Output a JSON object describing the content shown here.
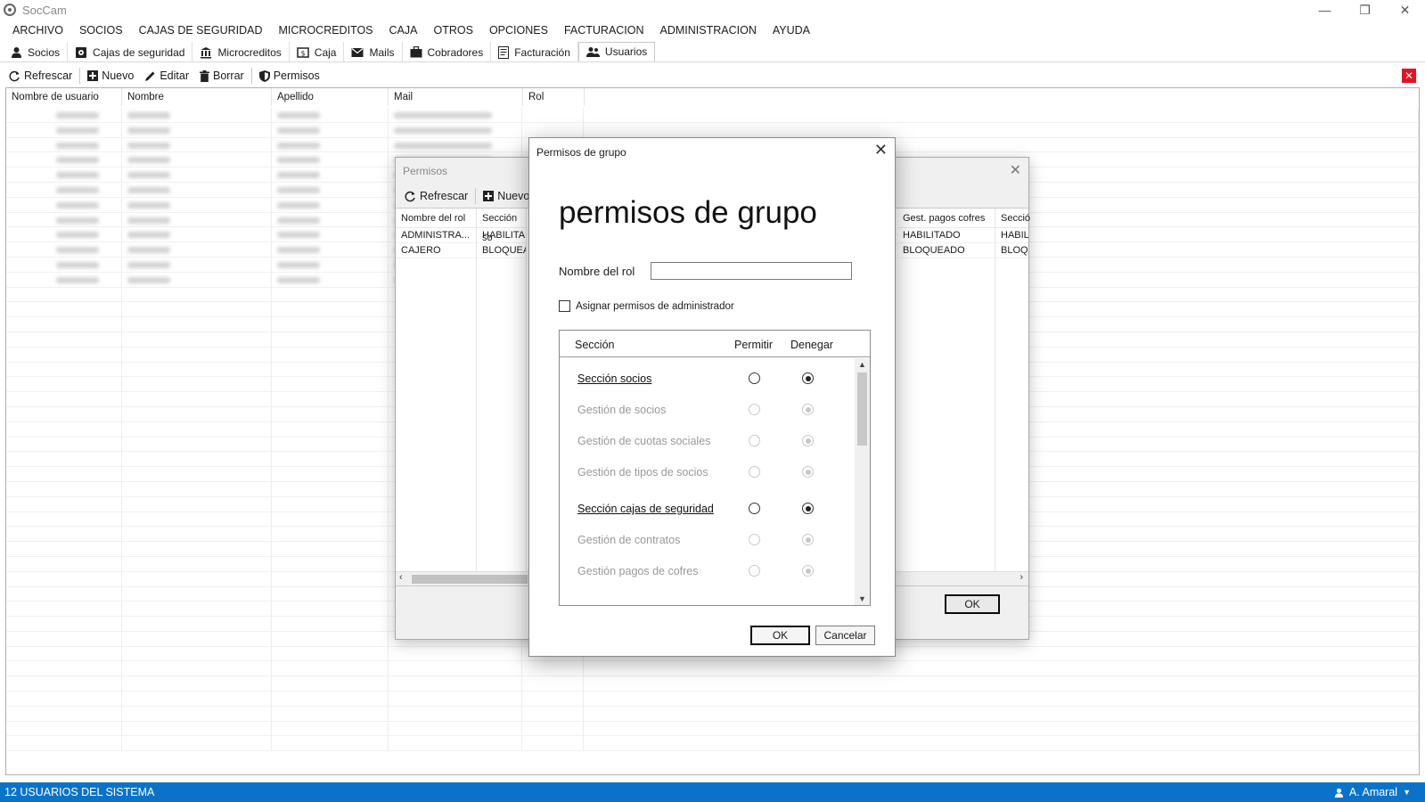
{
  "app": {
    "title": "SocCam"
  },
  "menu": [
    "ARCHIVO",
    "SOCIOS",
    "CAJAS DE SEGURIDAD",
    "MICROCREDITOS",
    "CAJA",
    "OTROS",
    "OPCIONES",
    "FACTURACION",
    "ADMINISTRACION",
    "AYUDA"
  ],
  "tabs": [
    "Socios",
    "Cajas de seguridad",
    "Microcreditos",
    "Caja",
    "Mails",
    "Cobradores",
    "Facturación",
    "Usuarios"
  ],
  "active_tab": "Usuarios",
  "toolbar": {
    "refresh": "Refrescar",
    "new": "Nuevo",
    "edit": "Editar",
    "delete": "Borrar",
    "permissions": "Permisos"
  },
  "grid": {
    "columns": [
      "Nombre de usuario",
      "Nombre",
      "Apellido",
      "Mail",
      "Rol"
    ]
  },
  "status": {
    "left": "12 USUARIOS DEL SISTEMA",
    "user": "A. Amaral"
  },
  "permisos_dialog": {
    "title": "Permisos",
    "refresh": "Refrescar",
    "new": "Nuevo",
    "col_role": "Nombre del rol",
    "col_section": "Sección so",
    "col_gest_pagos": "Gest. pagos cofres",
    "col_section_b": "Secció",
    "rows": [
      {
        "role": "ADMINISTRA...",
        "section": "HABILITAD",
        "gest": "HABILITADO",
        "section_b": "HABIL"
      },
      {
        "role": "CAJERO",
        "section": "BLOQUEA",
        "gest": "BLOQUEADO",
        "section_b": "BLOQU"
      }
    ],
    "ok": "OK"
  },
  "modal": {
    "window_title": "Permisos de grupo",
    "heading": "permisos de grupo",
    "role_label": "Nombre del rol",
    "role_value": "",
    "admin_label": "Asignar permisos de administrador",
    "admin_checked": false,
    "col_section": "Sección",
    "col_allow": "Permitir",
    "col_deny": "Denegar",
    "sections": [
      {
        "label": "Sección socios",
        "kind": "main",
        "value": "deny"
      },
      {
        "label": "Gestión de socios",
        "kind": "sub",
        "value": "deny"
      },
      {
        "label": "Gestión de cuotas sociales",
        "kind": "sub",
        "value": "deny"
      },
      {
        "label": "Gestión de tipos de socios",
        "kind": "sub",
        "value": "deny"
      },
      {
        "label": "Sección cajas de seguridad",
        "kind": "main",
        "value": "deny"
      },
      {
        "label": "Gestión de contratos",
        "kind": "sub",
        "value": "deny"
      },
      {
        "label": "Gestión pagos de cofres",
        "kind": "sub",
        "value": "deny"
      }
    ],
    "ok": "OK",
    "cancel": "Cancelar"
  },
  "colors": {
    "status_bar": "#0a73c9",
    "close_red": "#e81123"
  },
  "icons": [
    "app-icon",
    "minimize-icon",
    "restore-icon",
    "close-icon",
    "user-icon",
    "safe-icon",
    "bank-icon",
    "cash-icon",
    "mail-icon",
    "briefcase-icon",
    "invoice-icon",
    "users-icon",
    "refresh-icon",
    "plus-icon",
    "pencil-icon",
    "trash-icon",
    "shield-icon"
  ]
}
